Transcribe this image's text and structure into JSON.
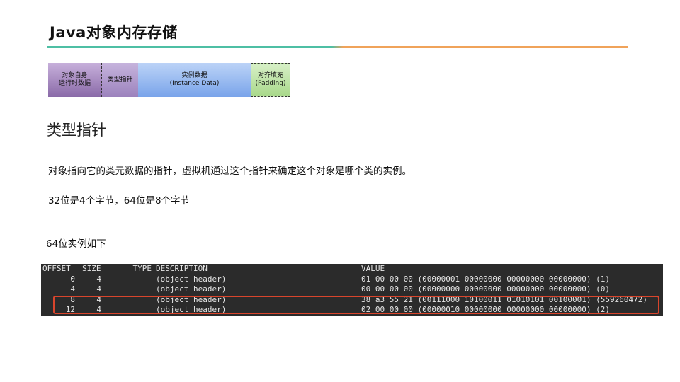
{
  "title": "Java对象内存存储",
  "diagram": {
    "segments": [
      {
        "label": "对象自身\n运行时数据"
      },
      {
        "label": "类型指针"
      },
      {
        "label": "实例数据\n(Instance Data)"
      },
      {
        "label": "对齐填充\n(Padding)"
      }
    ]
  },
  "section_heading": "类型指针",
  "paragraphs": [
    "对象指向它的类元数据的指针，虚拟机通过这个指针来确定这个对象是哪个类的实例。",
    "32位是4个字节，64位是8个字节",
    "64位实例如下"
  ],
  "console": {
    "headers": {
      "offset": "OFFSET",
      "size": "SIZE",
      "type": "TYPE",
      "description": "DESCRIPTION",
      "value": "VALUE"
    },
    "rows": [
      {
        "offset": "0",
        "size": "4",
        "description": "(object header)",
        "value": "01 00 00 00 (00000001 00000000 00000000 00000000) (1)"
      },
      {
        "offset": "4",
        "size": "4",
        "description": "(object header)",
        "value": "00 00 00 00 (00000000 00000000 00000000 00000000) (0)"
      },
      {
        "offset": "8",
        "size": "4",
        "description": "(object header)",
        "value": "38 a3 55 21 (00111000 10100011 01010101 00100001) (559260472)"
      },
      {
        "offset": "12",
        "size": "4",
        "description": "(object header)",
        "value": "02 00 00 00 (00000010 00000000 00000000 00000000) (2)"
      }
    ],
    "highlight_color": "#d9452c"
  },
  "colors": {
    "rule_left": "#4ebfa4",
    "rule_right": "#f0a35a",
    "console_bg": "#2b2b2b"
  }
}
